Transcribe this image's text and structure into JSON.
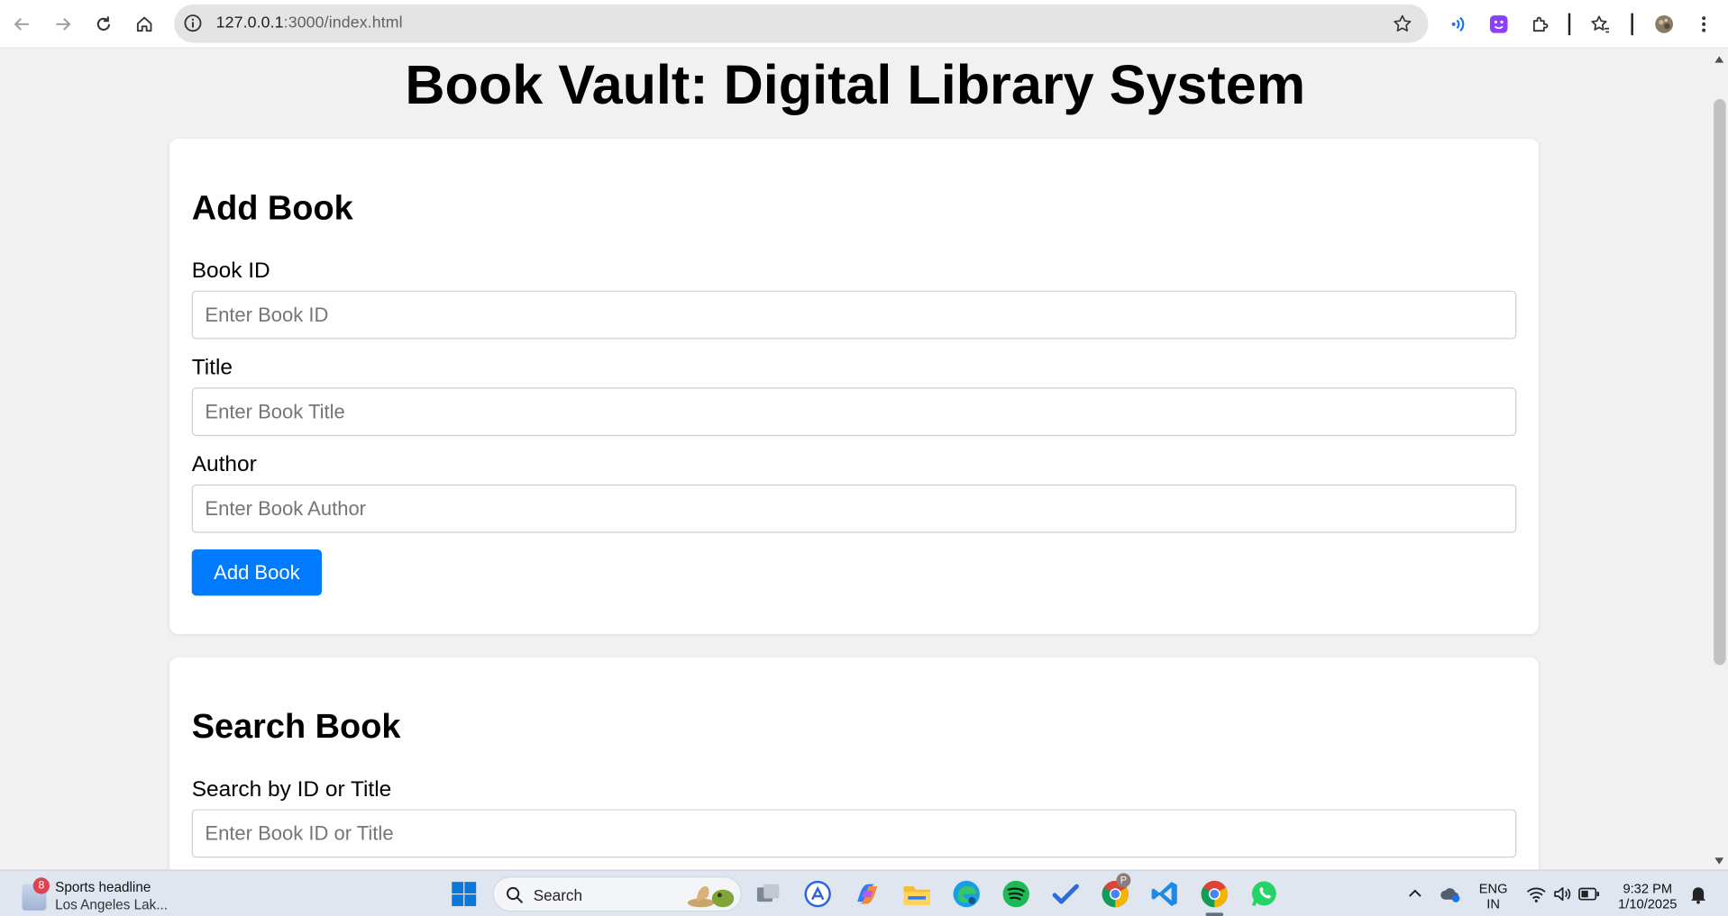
{
  "browser": {
    "url_host": "127.0.0.1",
    "url_rest": ":3000/index.html"
  },
  "page": {
    "title": "Book Vault: Digital Library System",
    "add_section": {
      "heading": "Add Book",
      "book_id_label": "Book ID",
      "book_id_placeholder": "Enter Book ID",
      "title_label": "Title",
      "title_placeholder": "Enter Book Title",
      "author_label": "Author",
      "author_placeholder": "Enter Book Author",
      "submit_label": "Add Book"
    },
    "search_section": {
      "heading": "Search Book",
      "search_label": "Search by ID or Title",
      "search_placeholder": "Enter Book ID or Title"
    }
  },
  "taskbar": {
    "news_badge": "8",
    "news_title": "Sports headline",
    "news_subtitle": "Los Angeles Lak...",
    "search_label": "Search",
    "language_line1": "ENG",
    "language_line2": "IN",
    "time": "9:32 PM",
    "date": "1/10/2025",
    "profile_badge": "P"
  },
  "colors": {
    "accent": "#007bff",
    "page_background": "#f1f1f1",
    "card_background": "#ffffff"
  }
}
